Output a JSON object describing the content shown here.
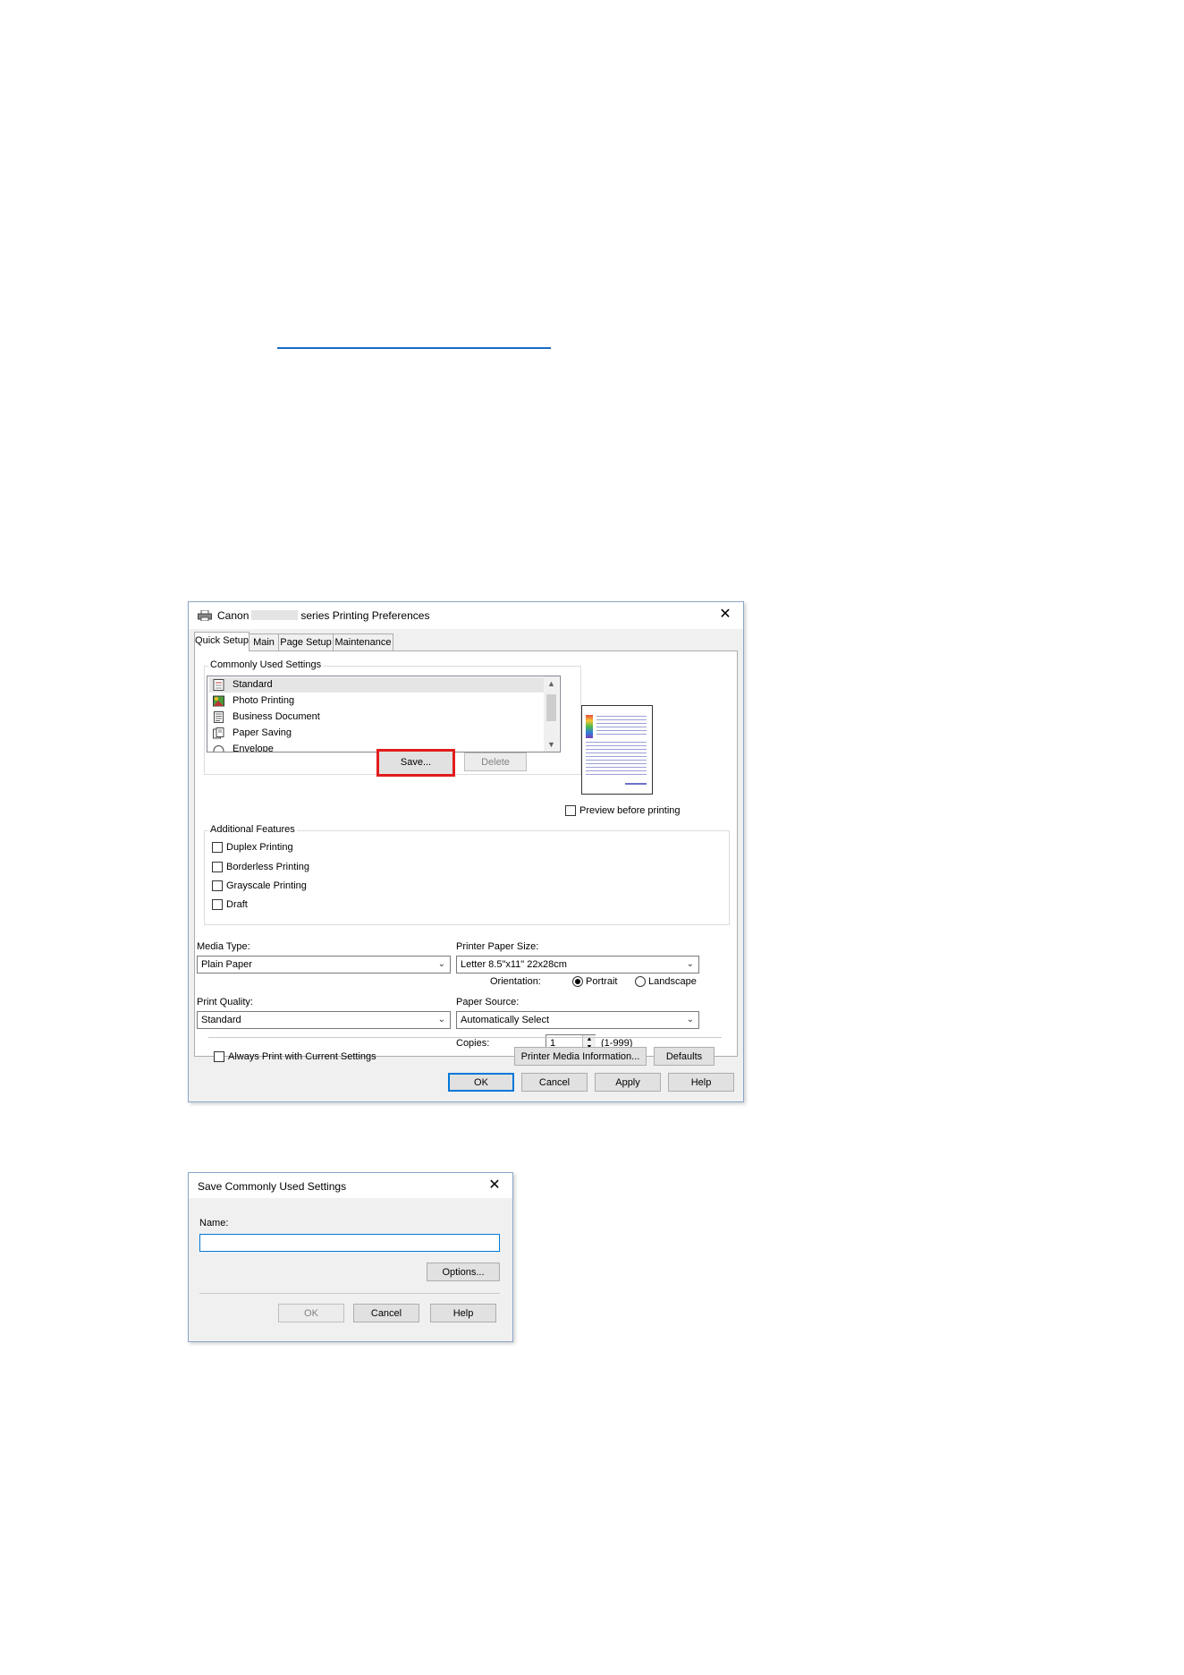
{
  "main_dialog": {
    "title_prefix": "Canon",
    "title_suffix": "series Printing Preferences",
    "close_glyph": "✕",
    "tabs": [
      {
        "label": "Quick Setup",
        "active": true
      },
      {
        "label": "Main",
        "active": false
      },
      {
        "label": "Page Setup",
        "active": false
      },
      {
        "label": "Maintenance",
        "active": false
      }
    ],
    "commonly_used": {
      "group_label": "Commonly Used Settings",
      "items": [
        {
          "label": "Standard",
          "icon": "standard-icon",
          "selected": true
        },
        {
          "label": "Photo Printing",
          "icon": "photo-icon",
          "selected": false
        },
        {
          "label": "Business Document",
          "icon": "document-icon",
          "selected": false
        },
        {
          "label": "Paper Saving",
          "icon": "paper-saving-icon",
          "selected": false
        },
        {
          "label": "Envelope",
          "icon": "envelope-icon",
          "selected": false
        }
      ],
      "save_label": "Save...",
      "delete_label": "Delete"
    },
    "preview": {
      "checkbox_label": "Preview before printing",
      "checked": false
    },
    "additional_features": {
      "group_label": "Additional Features",
      "items": [
        {
          "label": "Duplex Printing",
          "checked": false
        },
        {
          "label": "Borderless Printing",
          "checked": false
        },
        {
          "label": "Grayscale Printing",
          "checked": false
        },
        {
          "label": "Draft",
          "checked": false
        }
      ]
    },
    "media_type": {
      "label": "Media Type:",
      "value": "Plain Paper"
    },
    "printer_paper_size": {
      "label": "Printer Paper Size:",
      "value": "Letter 8.5\"x11\" 22x28cm"
    },
    "orientation": {
      "label": "Orientation:",
      "portrait": "Portrait",
      "landscape": "Landscape",
      "selected": "Portrait"
    },
    "print_quality": {
      "label": "Print Quality:",
      "value": "Standard"
    },
    "paper_source": {
      "label": "Paper Source:",
      "value": "Automatically Select"
    },
    "copies": {
      "label": "Copies:",
      "value": "1",
      "range": "(1-999)"
    },
    "always_print_label": "Always Print with Current Settings",
    "printer_media_info_label": "Printer Media Information...",
    "defaults_label": "Defaults",
    "footer": {
      "ok": "OK",
      "cancel": "Cancel",
      "apply": "Apply",
      "help": "Help"
    },
    "chevron": "⌄",
    "colors": {
      "highlight": "#e21c1c",
      "accent": "#0078d7"
    }
  },
  "save_dialog": {
    "title": "Save Commonly Used Settings",
    "close_glyph": "✕",
    "name_label": "Name:",
    "name_value": "",
    "options_label": "Options...",
    "ok": "OK",
    "cancel": "Cancel",
    "help": "Help"
  }
}
